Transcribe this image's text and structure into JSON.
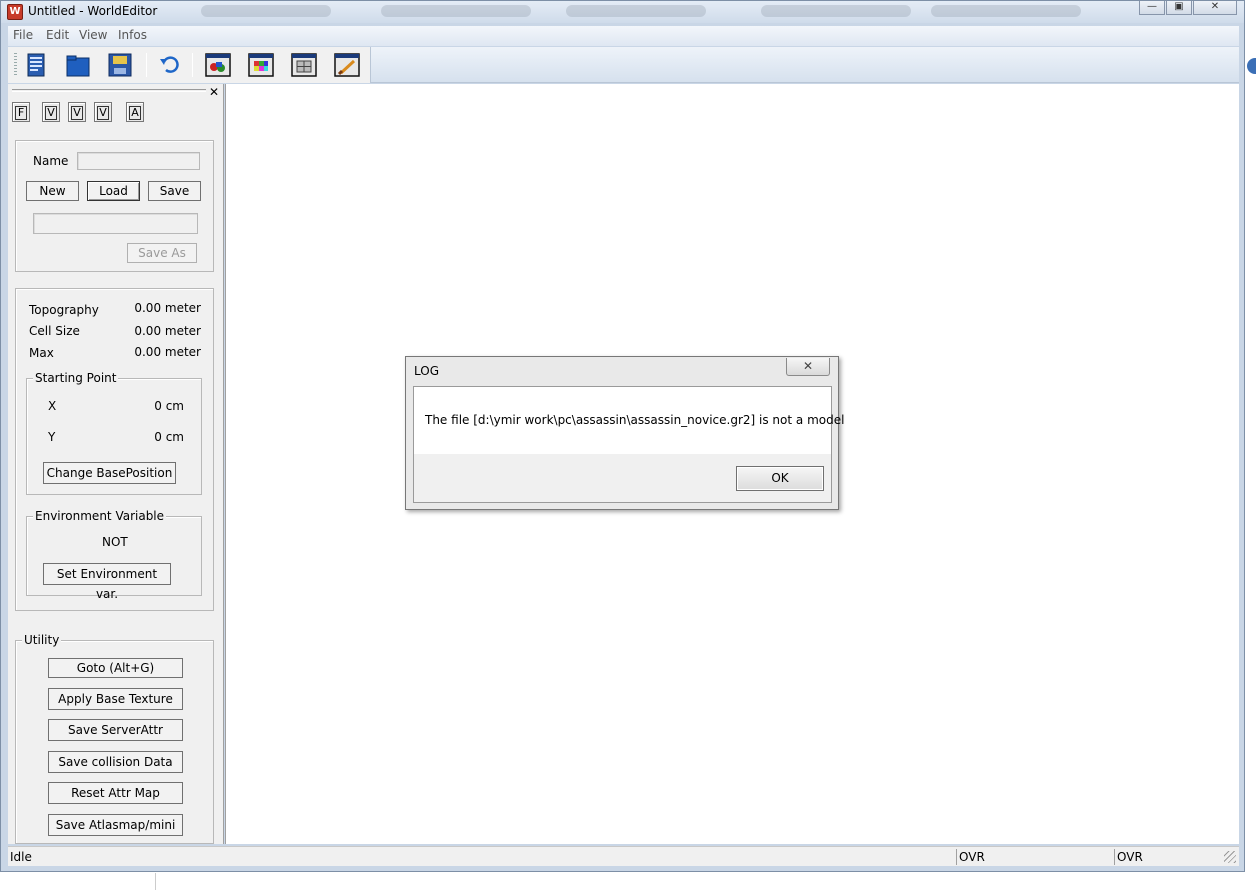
{
  "window": {
    "title": "Untitled - WorldEditor"
  },
  "menu": [
    "File",
    "Edit",
    "View",
    "Infos"
  ],
  "toolbar": {
    "buttons": [
      "new-file-icon",
      "open-folder-icon",
      "save-disk-icon",
      "undo-icon",
      "objects-view-icon",
      "palette-view-icon",
      "grid-view-icon",
      "brush-view-icon"
    ]
  },
  "panel_tabs": [
    "F",
    "V",
    "V",
    "V",
    "A"
  ],
  "file_section": {
    "name_label": "Name",
    "name_value": "",
    "new_label": "New",
    "load_label": "Load",
    "save_label": "Save",
    "path_value": "",
    "save_as_label": "Save As"
  },
  "map_info": {
    "topography_label": "Topography",
    "topography_value": "0.00 meter",
    "cell_size_label": "Cell Size",
    "cell_size_value": "0.00 meter",
    "max_label": "Max",
    "max_value": "0.00 meter"
  },
  "starting_point": {
    "title": "Starting Point",
    "x_label": "X",
    "x_value": "0 cm",
    "y_label": "Y",
    "y_value": "0 cm",
    "change_button": "Change BasePosition"
  },
  "environment": {
    "title": "Environment Variable",
    "value": "NOT",
    "set_button": "Set Environment var."
  },
  "utility": {
    "title": "Utility",
    "buttons": [
      "Goto (Alt+G)",
      "Apply Base Texture",
      "Save ServerAttr",
      "Save collision Data",
      "Reset Attr Map",
      "Save Atlasmap/mini"
    ]
  },
  "status": {
    "main": "Idle",
    "pane1": "OVR",
    "pane2": "OVR"
  },
  "dialog": {
    "title": "LOG",
    "close_glyph": "✕",
    "message": "The file [d:\\ymir work\\pc\\assassin\\assassin_novice.gr2] is not a model",
    "ok_label": "OK"
  },
  "colors": {
    "accent": "#3b6fb6",
    "frame": "#c9d6e6"
  }
}
